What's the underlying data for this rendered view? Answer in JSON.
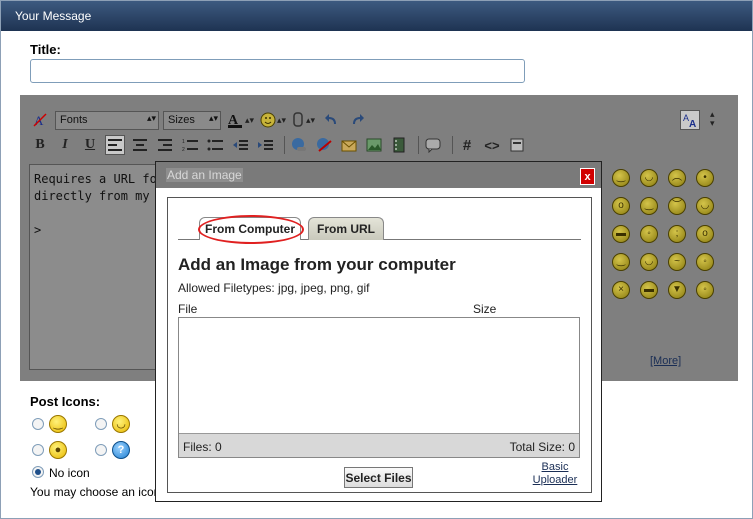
{
  "header": {
    "title": "Your Message"
  },
  "form": {
    "title_label": "Title:",
    "title_value": ""
  },
  "toolbar": {
    "font_select": "Fonts",
    "size_select": "Sizes",
    "bold": "B",
    "italic": "I",
    "underline": "U",
    "hash": "#",
    "code": "<>"
  },
  "editor": {
    "content": "Requires a URL for\ndirectly from my co\n\n>"
  },
  "smilies": {
    "more_label": "[More]"
  },
  "post_icons": {
    "label": "Post Icons:",
    "no_icon_label": "No icon",
    "hint": "You may choose an icon"
  },
  "modal": {
    "title": "Add an Image",
    "close_label": "x",
    "tabs": [
      {
        "label": "From Computer",
        "active": true
      },
      {
        "label": "From URL",
        "active": false
      }
    ],
    "heading": "Add an Image from your computer",
    "filetypes": "Allowed Filetypes: jpg, jpeg, png, gif",
    "columns": {
      "file": "File",
      "size": "Size"
    },
    "files_count": "Files: 0",
    "total_size": "Total Size: 0",
    "select_files_label": "Select Files",
    "basic_uploader_line1": "Basic",
    "basic_uploader_line2": "Uploader"
  }
}
